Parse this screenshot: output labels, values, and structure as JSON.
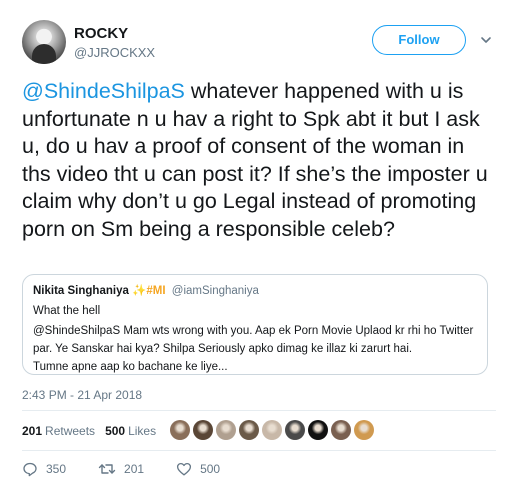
{
  "tweet": {
    "author_name": "ROCKY",
    "author_handle": "@JJROCKXX",
    "follow_label": "Follow",
    "mention": "@ShindeShilpaS",
    "text": " whatever happened with u is unfortunate n u hav a right to Spk abt it but I ask u, do u hav a proof of consent of the woman in ths video tht u can post it? If she’s the imposter u claim why don’t u go Legal instead of promoting porn on Sm being a responsible celeb?",
    "timestamp": "2:43 PM - 21 Apr 2018"
  },
  "quote": {
    "name": "Nikita Singhaniya",
    "emoji_tag": "✨#MI",
    "handle": "@iamSinghaniya",
    "lines": [
      "What the hell",
      "@ShindeShilpaS Mam wts wrong with you. Aap ek Porn Movie Uplaod kr rhi ho Twitter",
      "par. Ye Sanskar hai kya? Shilpa Seriously apko dimag ke illaz ki zarurt hai.",
      "Tumne apne aap ko bachane ke liye..."
    ]
  },
  "stats": {
    "retweets_count": "201",
    "retweets_label": "Retweets",
    "likes_count": "500",
    "likes_label": "Likes",
    "liker_colors": [
      "#8a6f5a",
      "#5a4636",
      "#b0a090",
      "#6b5a48",
      "#c8b8a8",
      "#4a4a4a",
      "#111111",
      "#7a6050",
      "#d09a50"
    ]
  },
  "actions": {
    "reply_count": "350",
    "retweet_count": "201",
    "like_count": "500"
  },
  "colors": {
    "accent": "#1da1f2",
    "link": "#1b95e0",
    "muted": "#657786"
  }
}
